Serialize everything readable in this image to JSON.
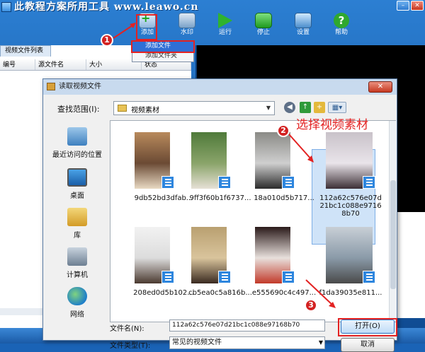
{
  "app": {
    "title": "此教程方案所用工具 www.leawo.cn",
    "toolbar": [
      {
        "label": "添加",
        "icon": "add-video-icon"
      },
      {
        "label": "水印",
        "icon": "watermark-icon"
      },
      {
        "label": "运行",
        "icon": "run-arrow-icon"
      },
      {
        "label": "停止",
        "icon": "stop-icon"
      },
      {
        "label": "设置",
        "icon": "settings-icon"
      },
      {
        "label": "帮助",
        "icon": "help-icon"
      }
    ],
    "add_menu": [
      "添加文件",
      "添加文件夹"
    ],
    "list_tab": "视频文件列表",
    "list_columns": [
      "编号",
      "源文件名",
      "大小",
      "状态"
    ]
  },
  "dialog": {
    "title": "读取视频文件",
    "look_in_label": "查找范围(I):",
    "look_in_value": "视频素材",
    "places": [
      "最近访问的位置",
      "桌面",
      "库",
      "计算机",
      "网络"
    ],
    "files": [
      {
        "name": "9db52bd3dfab...",
        "colors": [
          "#b88a5c",
          "#e8d9c3",
          "#6b4a34"
        ]
      },
      {
        "name": "9ff3f60b1f6737...",
        "colors": [
          "#4f7a3a",
          "#e6e0d6",
          "#8aa46a"
        ]
      },
      {
        "name": "18a010d5b717...",
        "colors": [
          "#8a8a86",
          "#2b2b2b",
          "#cfcfcf"
        ]
      },
      {
        "name": "112a62c576e07d21bc1c088e97168b70",
        "colors": [
          "#c9c2c9",
          "#3c2f36",
          "#e9e4ea"
        ]
      },
      {
        "name": "208ed0d5b102...",
        "colors": [
          "#f2f2f2",
          "#4b3a30",
          "#dcdcdc"
        ]
      },
      {
        "name": "cb5ea0c5a816b...",
        "colors": [
          "#b9a070",
          "#3a2a20",
          "#d9c49c"
        ]
      },
      {
        "name": "e555690c4c497...",
        "colors": [
          "#2a1a1a",
          "#c23a2a",
          "#e8e0dc"
        ]
      },
      {
        "name": "f1da39035e811...",
        "colors": [
          "#c8cfd6",
          "#4a4a4a",
          "#8a9aa8"
        ]
      }
    ],
    "filename_label": "文件名(N):",
    "filename_value": "112a62c576e07d21bc1c088e97168b70",
    "filetype_label": "文件类型(T):",
    "filetype_value": "常见的视频文件",
    "open_button": "打开(O)",
    "cancel_button": "取消"
  },
  "annotations": {
    "step1": "1",
    "step2": "2",
    "step3": "3",
    "caption": "选择视频素材",
    "color": "#e32222"
  }
}
